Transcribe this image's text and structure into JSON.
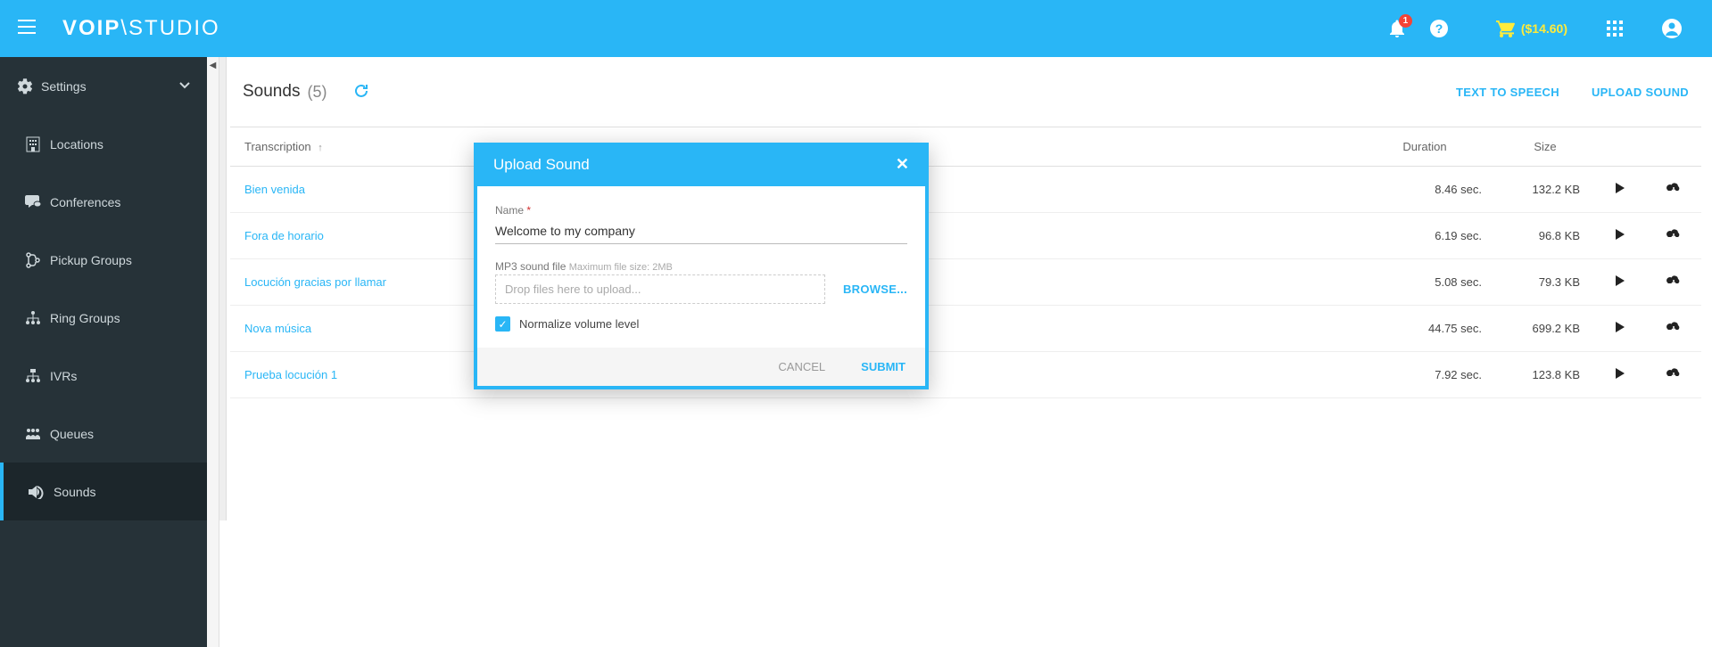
{
  "topbar": {
    "logo_left": "VOIP",
    "logo_right": "STUDIO",
    "notif_count": "1",
    "balance": "($14.60)"
  },
  "sidebar": {
    "settings": "Settings",
    "items": [
      {
        "label": "Locations"
      },
      {
        "label": "Conferences"
      },
      {
        "label": "Pickup Groups"
      },
      {
        "label": "Ring Groups"
      },
      {
        "label": "IVRs"
      },
      {
        "label": "Queues"
      },
      {
        "label": "Sounds"
      }
    ]
  },
  "page": {
    "title": "Sounds",
    "count": "(5)",
    "action_tts": "TEXT TO SPEECH",
    "action_upload": "UPLOAD SOUND"
  },
  "table": {
    "col_transcription": "Transcription",
    "col_duration": "Duration",
    "col_size": "Size",
    "rows": [
      {
        "name": "Bien venida",
        "duration": "8.46 sec.",
        "size": "132.2 KB"
      },
      {
        "name": "Fora de horario",
        "duration": "6.19 sec.",
        "size": "96.8 KB"
      },
      {
        "name": "Locución gracias por llamar",
        "duration": "5.08 sec.",
        "size": "79.3 KB"
      },
      {
        "name": "Nova música",
        "duration": "44.75 sec.",
        "size": "699.2 KB"
      },
      {
        "name": "Prueba locución 1",
        "duration": "7.92 sec.",
        "size": "123.8 KB"
      }
    ]
  },
  "modal": {
    "title": "Upload Sound",
    "name_label": "Name",
    "name_value": "Welcome to my company",
    "file_label": "MP3 sound file",
    "file_hint": "Maximum file size: 2MB",
    "dropzone": "Drop files here to upload...",
    "browse": "BROWSE...",
    "normalize": "Normalize volume level",
    "cancel": "CANCEL",
    "submit": "SUBMIT"
  }
}
